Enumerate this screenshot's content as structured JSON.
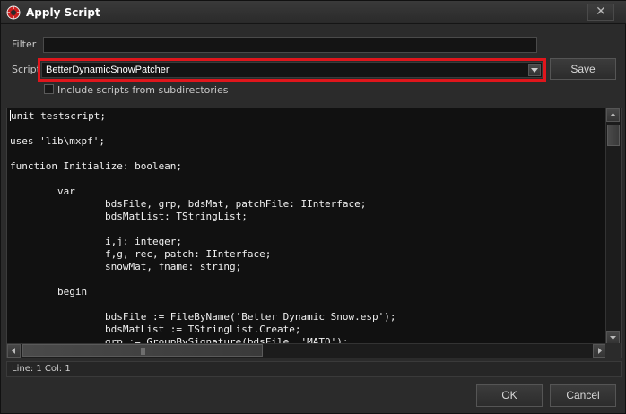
{
  "window": {
    "title": "Apply Script",
    "close_glyph": "✕",
    "app_icon": "xedit-logo-icon",
    "highlight_color": "#e0161c"
  },
  "filter": {
    "label": "Filter",
    "value": ""
  },
  "script": {
    "label": "Script",
    "selected": "BetterDynamicSnowPatcher",
    "save_label": "Save"
  },
  "subdirectories": {
    "label": "Include scripts from subdirectories",
    "checked": false
  },
  "editor": {
    "lines": [
      "unit testscript;",
      "",
      "uses 'lib\\mxpf';",
      "",
      "function Initialize: boolean;",
      "",
      "        var",
      "                bdsFile, grp, bdsMat, patchFile: IInterface;",
      "                bdsMatList: TStringList;",
      "",
      "                i,j: integer;",
      "                f,g, rec, patch: IInterface;",
      "                snowMat, fname: string;",
      "",
      "        begin",
      "",
      "                bdsFile := FileByName('Better Dynamic Snow.esp');",
      "                bdsMatList := TStringList.Create;",
      "                grp := GroupBySignature(bdsFile, 'MATO');"
    ]
  },
  "status": {
    "text": "Line: 1 Col: 1"
  },
  "buttons": {
    "ok_label": "OK",
    "cancel_label": "Cancel"
  }
}
